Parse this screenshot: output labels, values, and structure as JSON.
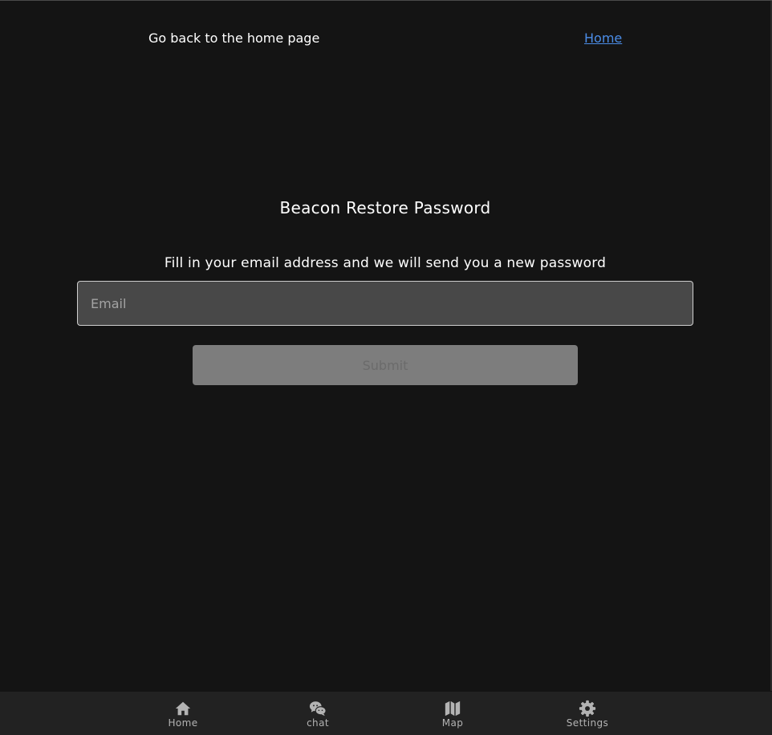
{
  "header": {
    "back_text": "Go back to the home page",
    "home_link": "Home"
  },
  "form": {
    "title": "Beacon Restore Password",
    "instructions": "Fill in your email address and we will send you a new password",
    "email_placeholder": "Email",
    "email_value": "",
    "submit_label": "Submit"
  },
  "bottom_nav": {
    "items": [
      {
        "label": "Home",
        "icon": "home-icon"
      },
      {
        "label": "chat",
        "icon": "chat-icon"
      },
      {
        "label": "Map",
        "icon": "map-icon"
      },
      {
        "label": "Settings",
        "icon": "gear-icon"
      }
    ]
  },
  "colors": {
    "background": "#141414",
    "link": "#4b8de8",
    "input_bg": "#484848",
    "button_bg": "#7d7d7d",
    "nav_bg": "#222222"
  }
}
